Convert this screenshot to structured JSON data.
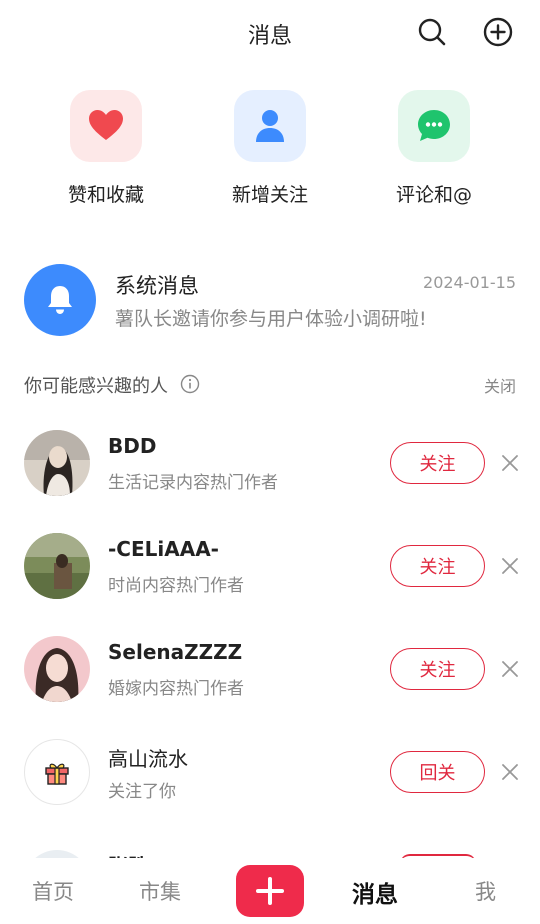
{
  "header": {
    "title": "消息",
    "search_icon": "search-icon",
    "add_icon": "plus-circle-icon"
  },
  "quick_entries": [
    {
      "label": "赞和收藏",
      "icon": "heart-icon",
      "color": "#f0494f"
    },
    {
      "label": "新增关注",
      "icon": "person-icon",
      "color": "#3d8bfd"
    },
    {
      "label": "评论和@",
      "icon": "chat-bubble-icon",
      "color": "#1fc46d"
    }
  ],
  "system_message": {
    "title": "系统消息",
    "date": "2024-01-15",
    "text": "薯队长邀请你参与用户体验小调研啦!",
    "icon": "bell-icon",
    "color": "#3d8bfd"
  },
  "recommend": {
    "title": "你可能感兴趣的人",
    "close_label": "关闭",
    "users": [
      {
        "name": "BDD",
        "desc": "生活记录内容热门作者",
        "button": "关注"
      },
      {
        "name": "-CELiAAA-",
        "desc": "时尚内容热门作者",
        "button": "关注"
      },
      {
        "name": "SelenaZZZZ",
        "desc": "婚嫁内容热门作者",
        "button": "关注"
      },
      {
        "name": "高山流水",
        "desc": "关注了你",
        "button": "回关"
      }
    ],
    "partial_user_name": "张胜"
  },
  "tabbar": {
    "home": "首页",
    "market": "市集",
    "messages": "消息",
    "me": "我",
    "accent": "#ef2b4b"
  }
}
